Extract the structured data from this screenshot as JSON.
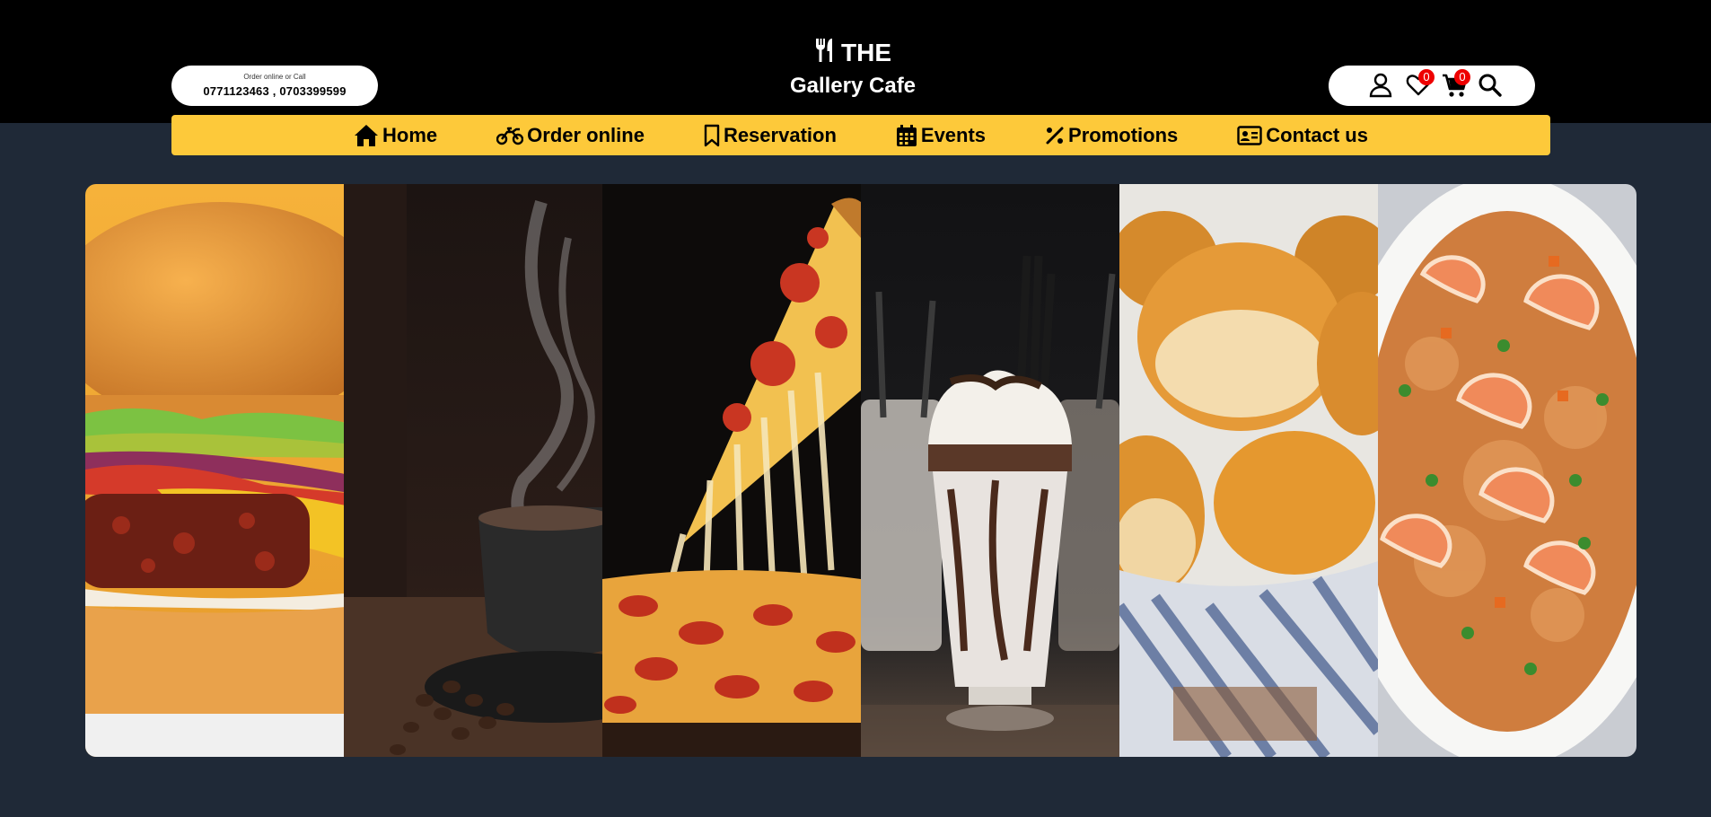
{
  "header": {
    "contact_label": "Order online or Call",
    "contact_phone": "0771123463 , 0703399599",
    "brand_line1": "THE",
    "brand_line2": "Gallery Cafe",
    "wishlist_count": "0",
    "cart_count": "0"
  },
  "nav": [
    {
      "label": "Home",
      "icon": "home-icon"
    },
    {
      "label": "Order online",
      "icon": "motorcycle-icon"
    },
    {
      "label": "Reservation",
      "icon": "bookmark-icon"
    },
    {
      "label": "Events",
      "icon": "calendar-icon"
    },
    {
      "label": "Promotions",
      "icon": "percent-icon"
    },
    {
      "label": "Contact us",
      "icon": "contact-card-icon"
    }
  ],
  "gallery": [
    {
      "subject": "burger-image"
    },
    {
      "subject": "coffee-image"
    },
    {
      "subject": "pizza-image"
    },
    {
      "subject": "milkshake-image"
    },
    {
      "subject": "bread-rolls-image"
    },
    {
      "subject": "shrimp-fried-rice-image"
    }
  ],
  "colors": {
    "topbar": "#000000",
    "page_background": "#1f2937",
    "nav_background": "#fdc93a",
    "badge": "#ee0000"
  }
}
